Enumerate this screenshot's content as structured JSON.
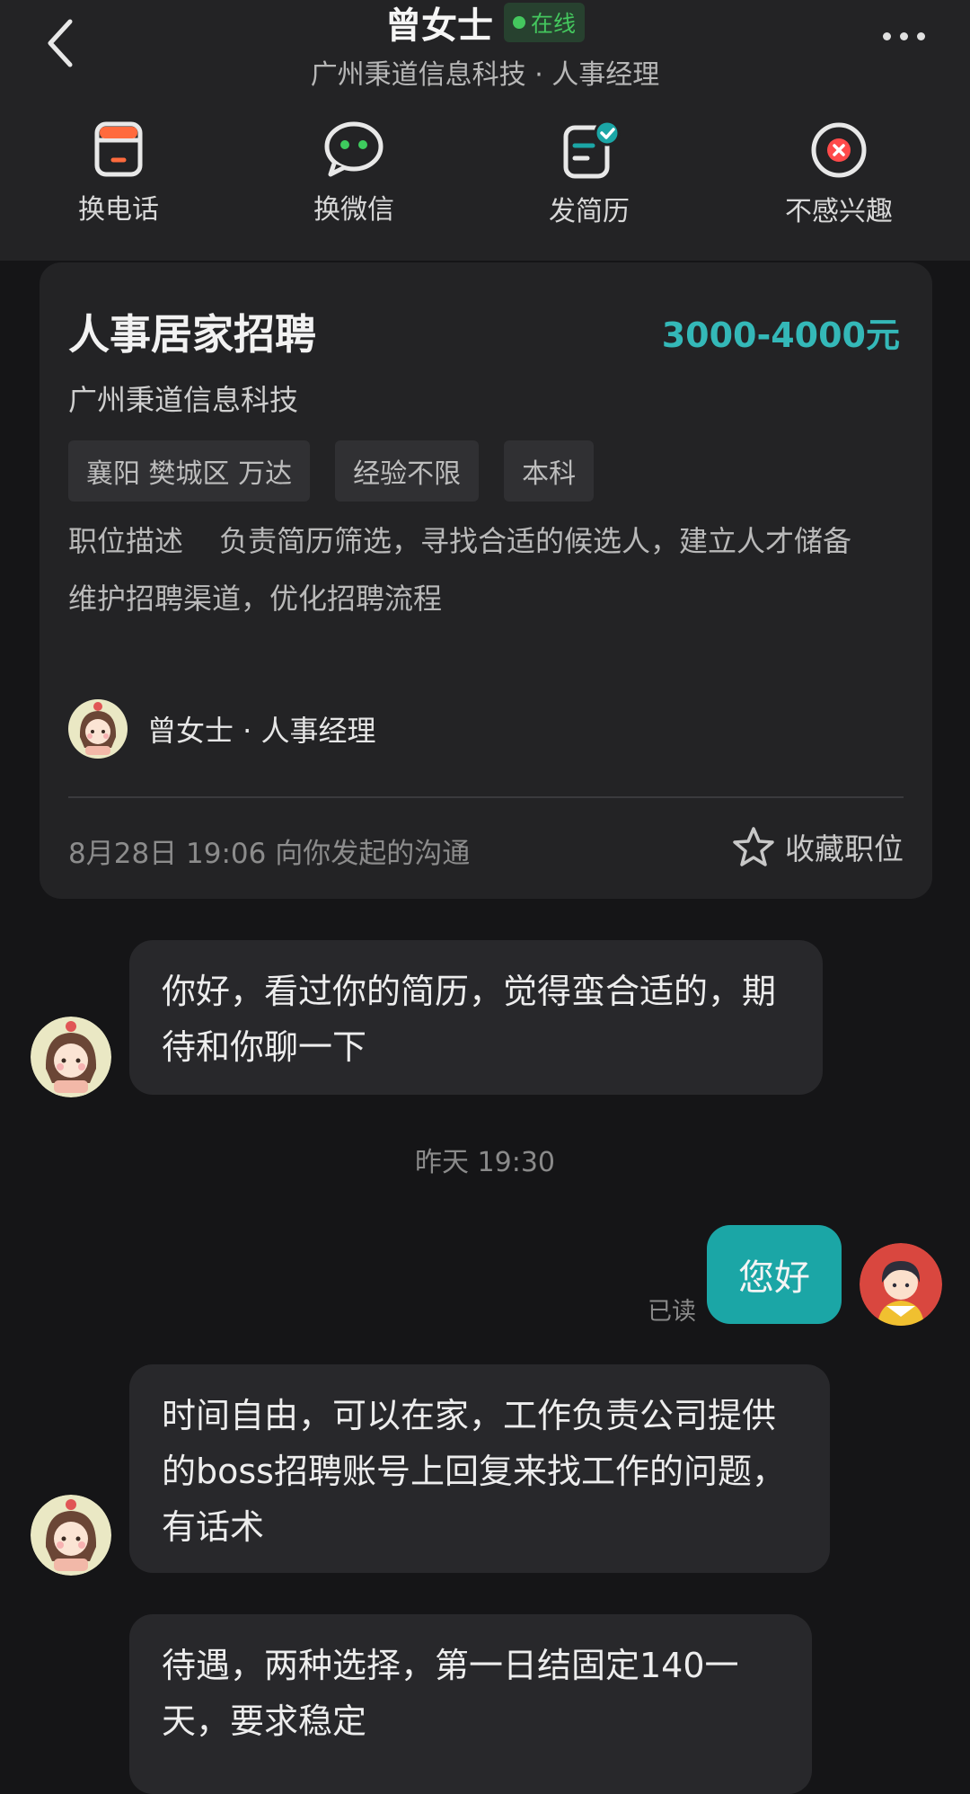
{
  "header": {
    "name": "曾女士",
    "online_label": "在线",
    "subtitle": "广州秉道信息科技 · 人事经理",
    "more_icon": "more-icon",
    "back_icon": "back-arrow-icon"
  },
  "actions": [
    {
      "label": "换电话",
      "icon": "phone-icon"
    },
    {
      "label": "换微信",
      "icon": "wechat-icon"
    },
    {
      "label": "发简历",
      "icon": "resume-icon"
    },
    {
      "label": "不感兴趣",
      "icon": "not-interested-icon"
    }
  ],
  "job": {
    "title": "人事居家招聘",
    "salary": "3000-4000元",
    "company": "广州秉道信息科技",
    "tags": [
      "襄阳 樊城区 万达",
      "经验不限",
      "本科"
    ],
    "desc_label": "职位描述",
    "desc_line1": "负责简历筛选，寻找合适的候选人，建立人才储备",
    "desc_line2": "维护招聘渠道，优化招聘流程",
    "recruiter": "曾女士 · 人事经理",
    "started": "8月28日 19:06 向你发起的沟通",
    "favorite_label": "收藏职位"
  },
  "messages": [
    {
      "from": "recruiter",
      "text": "你好，看过你的简历，觉得蛮合适的，期待和你聊一下"
    },
    {
      "separator": "昨天 19:30"
    },
    {
      "from": "me",
      "text": "您好",
      "status": "已读"
    },
    {
      "from": "recruiter",
      "text": "时间自由，可以在家，工作负责公司提供的boss招聘账号上回复来找工作的问题，有话术"
    },
    {
      "from": "recruiter",
      "text": "待遇，两种选择，第一日结固定140一天，要求稳定"
    }
  ],
  "colors": {
    "accent": "#1ba6a6",
    "salary": "#34b8b8",
    "online": "#44c75e",
    "background": "#151517",
    "panel": "#232325"
  }
}
